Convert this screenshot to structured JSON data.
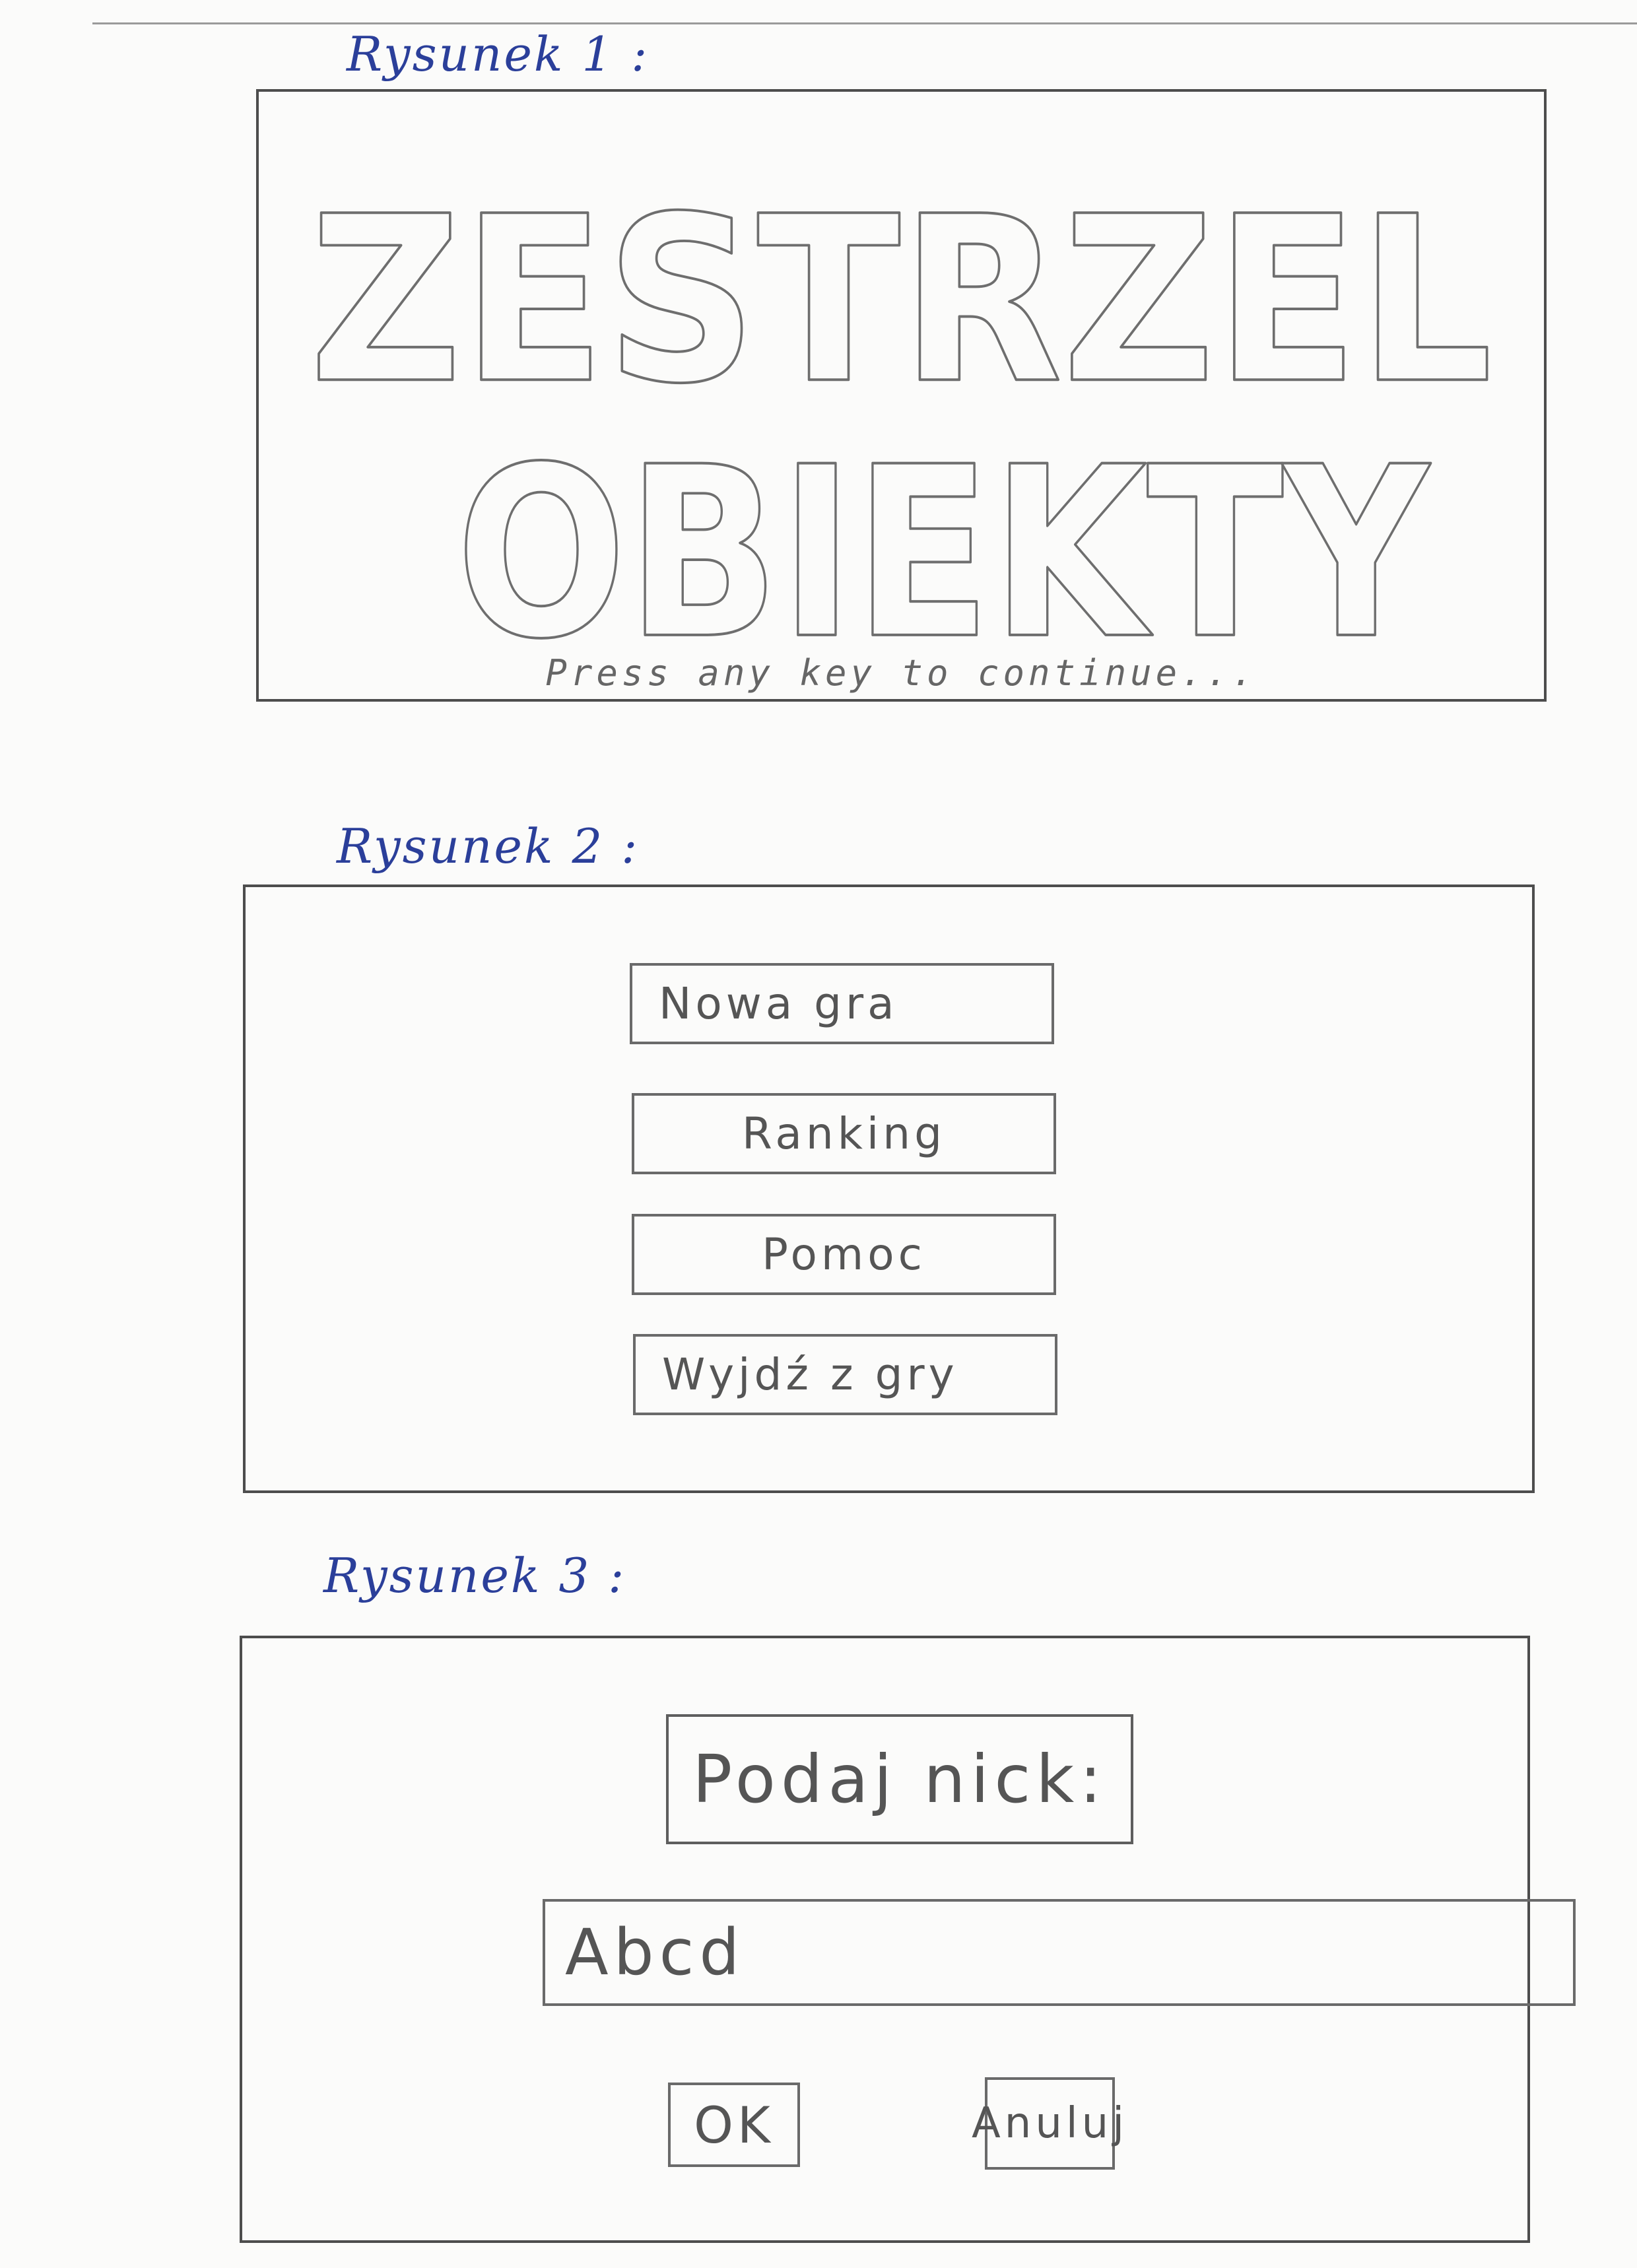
{
  "figure1": {
    "caption": "Rysunek 1 :",
    "title_line1": "ZESTRZEL",
    "title_line2": "OBIEKTY",
    "prompt": "Press any key to continue..."
  },
  "figure2": {
    "caption": "Rysunek 2 :",
    "menu": [
      {
        "label": "Nowa gra"
      },
      {
        "label": "Ranking"
      },
      {
        "label": "Pomoc"
      },
      {
        "label": "Wyjdź z gry"
      }
    ]
  },
  "figure3": {
    "caption": "Rysunek 3 :",
    "prompt": "Podaj nick:",
    "nick_value": "Abcd",
    "ok_label": "OK",
    "cancel_label": "Anuluj"
  },
  "colors": {
    "caption_ink": "#2b3f9a",
    "pencil": "#555555",
    "paper": "#fbfbfa"
  }
}
